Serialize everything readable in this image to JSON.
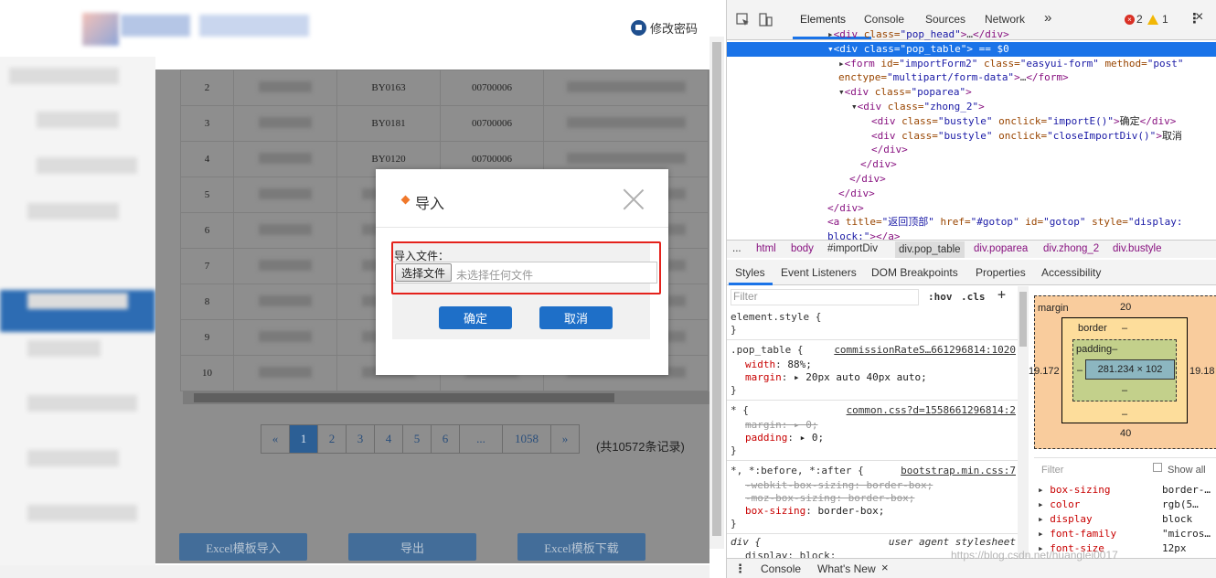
{
  "header": {
    "change_password": "修改密码"
  },
  "table": {
    "rows": [
      {
        "no": "2",
        "code": "BY0163",
        "num": "00700006"
      },
      {
        "no": "3",
        "code": "BY0181",
        "num": "00700006"
      },
      {
        "no": "4",
        "code": "BY0120",
        "num": "00700006"
      },
      {
        "no": "5",
        "code": "",
        "num": ""
      },
      {
        "no": "6",
        "code": "",
        "num": ""
      },
      {
        "no": "7",
        "code": "",
        "num": ""
      },
      {
        "no": "8",
        "code": "",
        "num": ""
      },
      {
        "no": "9",
        "code": "",
        "num": ""
      },
      {
        "no": "10",
        "code": "",
        "num": ""
      }
    ]
  },
  "pager": {
    "prev": "«",
    "pages": [
      "1",
      "2",
      "3",
      "4",
      "5",
      "6",
      "...",
      "1058"
    ],
    "next": "»",
    "total": "(共10572条记录)"
  },
  "bottom_buttons": {
    "import": "Excel模板导入",
    "export": "导出",
    "download": "Excel模板下载"
  },
  "dialog": {
    "title": "导入",
    "file_label": "导入文件：",
    "choose_file": "选择文件",
    "no_file": "未选择任何文件",
    "confirm": "确定",
    "cancel": "取消"
  },
  "devtools": {
    "tabs": [
      "Elements",
      "Console",
      "Sources",
      "Network"
    ],
    "more": "»",
    "errors": "2",
    "warnings": "1",
    "dom": [
      {
        "ind": 110,
        "html": "▸<span class='tag'>&lt;div</span> <span class='attr'>class=</span><span class='val'>\"pop_head\"</span><span class='tag'>&gt;</span>…<span class='tag'>&lt;/div&gt;</span>"
      },
      {
        "ind": 110,
        "sel": true,
        "html": "▾<span class='tag'>&lt;div</span> <span class='attr'>class=</span><span class='val'>\"pop_table\"</span><span class='tag'>&gt;</span> == $0"
      },
      {
        "ind": 122,
        "html": "▸<span class='tag'>&lt;form</span> <span class='attr'>id=</span><span class='val'>\"importForm2\"</span> <span class='attr'>class=</span><span class='val'>\"easyui-form\"</span> <span class='attr'>method=</span><span class='val'>\"post\"</span>"
      },
      {
        "ind": 122,
        "html": "<span class='attr'>enctype=</span><span class='val'>\"multipart/form-data\"</span><span class='tag'>&gt;</span>…<span class='tag'>&lt;/form&gt;</span>"
      },
      {
        "ind": 122,
        "html": "▾<span class='tag'>&lt;div</span> <span class='attr'>class=</span><span class='val'>\"poparea\"</span><span class='tag'>&gt;</span>"
      },
      {
        "ind": 136,
        "html": "▾<span class='tag'>&lt;div</span> <span class='attr'>class=</span><span class='val'>\"zhong_2\"</span><span class='tag'>&gt;</span>"
      },
      {
        "ind": 158,
        "html": "<span class='tag'>&lt;div</span> <span class='attr'>class=</span><span class='val'>\"bustyle\"</span> <span class='attr'>onclick=</span><span class='val'>\"importE()\"</span><span class='tag'>&gt;</span><span class='txt'>确定</span><span class='tag'>&lt;/div&gt;</span>"
      },
      {
        "ind": 158,
        "html": "<span class='tag'>&lt;div</span> <span class='attr'>class=</span><span class='val'>\"bustyle\"</span> <span class='attr'>onclick=</span><span class='val'>\"closeImportDiv()\"</span><span class='tag'>&gt;</span><span class='txt'>取消</span>"
      },
      {
        "ind": 158,
        "html": "<span class='tag'>&lt;/div&gt;</span>"
      },
      {
        "ind": 146,
        "html": "<span class='tag'>&lt;/div&gt;</span>"
      },
      {
        "ind": 134,
        "html": "<span class='tag'>&lt;/div&gt;</span>"
      },
      {
        "ind": 122,
        "html": "<span class='tag'>&lt;/div&gt;</span>"
      },
      {
        "ind": 110,
        "html": "<span class='tag'>&lt;/div&gt;</span>"
      },
      {
        "ind": 110,
        "html": "<span class='tag'>&lt;a</span> <span class='attr'>title=</span><span class='val'>\"返回顶部\"</span> <span class='attr'>href=</span><span class='val'>\"#gotop\"</span> <span class='attr'>id=</span><span class='val'>\"gotop\"</span> <span class='attr'>style=</span><span class='val'>\"display:</span>"
      },
      {
        "ind": 110,
        "html": "<span class='val'>block;\"</span><span class='tag'>&gt;&lt;/a&gt;</span>"
      }
    ],
    "breadcrumb": [
      "...",
      "html",
      "body",
      "#importDiv",
      "div.pop_table",
      "div.poparea",
      "div.zhong_2",
      "div.bustyle"
    ],
    "subtabs": [
      "Styles",
      "Event Listeners",
      "DOM Breakpoints",
      "Properties",
      "Accessibility"
    ],
    "filter_placeholder": "Filter",
    "hov": ":hov",
    "cls": ".cls",
    "plus": "+",
    "styles": {
      "element_style": "element.style {",
      "close_brace": "}",
      "rule1_selector": ".pop_table {",
      "rule1_source": "commissionRateS…661296814:1020",
      "rule1_p1": "width",
      "rule1_v1": "88%;",
      "rule1_p2": "margin",
      "rule1_v2": "▸ 20px auto 40px auto;",
      "rule2_selector": "* {",
      "rule2_source": "common.css?d=1558661296814:2",
      "rule2_p1": "margin",
      "rule2_v1": "▸ 0;",
      "rule2_p2": "padding",
      "rule2_v2": "▸ 0;",
      "rule3_selector": "*, *:before, *:after {",
      "rule3_source": "bootstrap.min.css:7",
      "rule3_l1": "-webkit-box-sizing: border-box;",
      "rule3_l2": "-moz-box-sizing: border-box;",
      "rule3_p3": "box-sizing",
      "rule3_v3": "border-box;",
      "rule4_selector": "div {",
      "rule4_source": "user agent stylesheet",
      "rule4_l1": "display: block;"
    },
    "boxmodel": {
      "margin_label": "margin",
      "margin_top": "20",
      "margin_bottom": "40",
      "margin_left": "19.172",
      "margin_right": "19.18",
      "border_label": "border",
      "border_val": "–",
      "padding_label": "padding–",
      "padding_bottom": "–",
      "content": "281.234 × 102",
      "dash": "–"
    },
    "computed": {
      "filter_placeholder": "Filter",
      "show_all": "Show all",
      "rows": [
        {
          "name": "box-sizing",
          "value": "border-…"
        },
        {
          "name": "color",
          "value": "rgb(5…"
        },
        {
          "name": "display",
          "value": "block"
        },
        {
          "name": "font-family",
          "value": "\"micros…"
        },
        {
          "name": "font-size",
          "value": "12px"
        }
      ]
    },
    "drawer": [
      "Console",
      "What's New"
    ],
    "watermark": "https://blog.csdn.net/huanglei0017"
  }
}
